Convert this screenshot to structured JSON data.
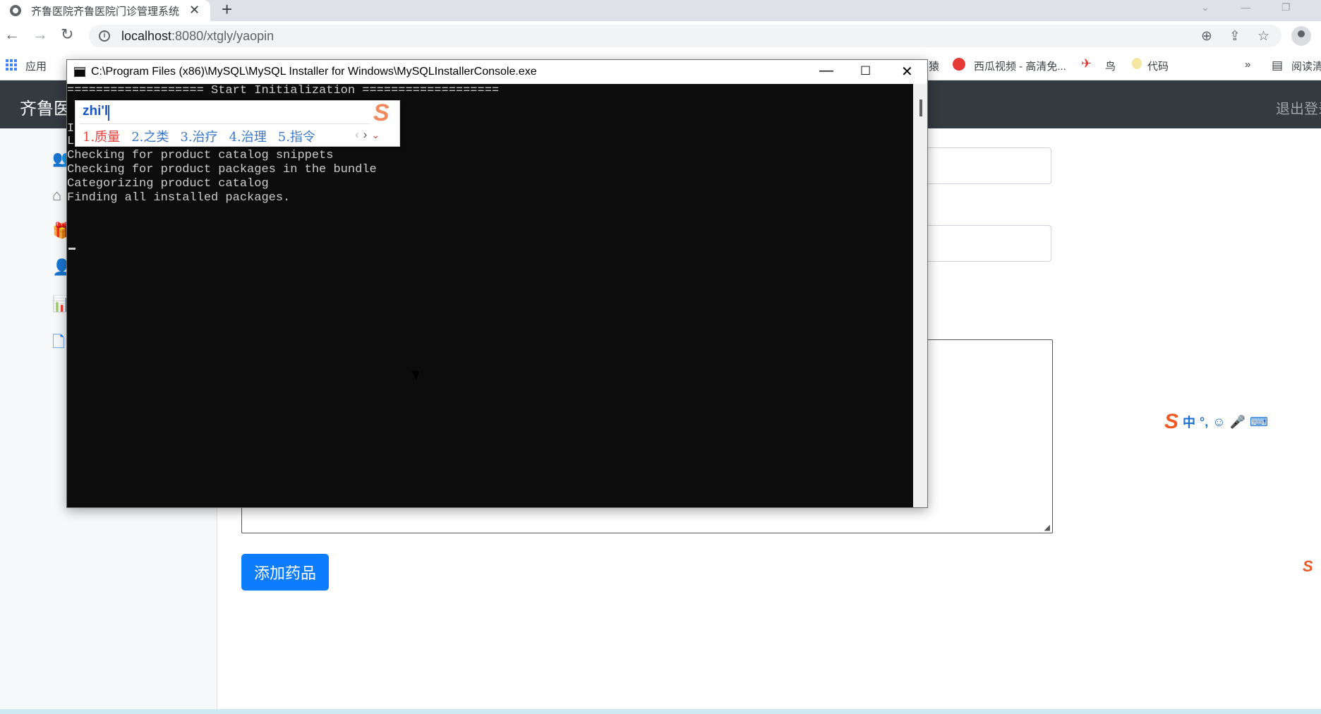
{
  "browser": {
    "tab_title": "齐鲁医院齐鲁医院门诊管理系统",
    "tab_close": "✕",
    "new_tab": "+",
    "url_host": "localhost",
    "url_rest": ":8080/xtgly/yaopin",
    "bookmarks": {
      "apps_label": "应用",
      "partial_left": "猿",
      "xigua": "西瓜视频 - 高清免...",
      "niao": "鸟",
      "daima": "代码",
      "more": "»",
      "reading": "阅读清"
    }
  },
  "app": {
    "brand": "齐鲁医院",
    "logout": "退出登录",
    "submit_label": "添加药品"
  },
  "console": {
    "title": "C:\\Program Files (x86)\\MySQL\\MySQL Installer for Windows\\MySQLInstallerConsole.exe",
    "lines": [
      "=================== Start Initialization ===================",
      "I",
      "Loading product catalog",
      "Checking for product catalog snippets",
      "Checking for product packages in the bundle",
      "Categorizing product catalog",
      "Finding all installed packages."
    ]
  },
  "ime": {
    "input": "zhi'l",
    "candidates": [
      "1.质量",
      "2.之类",
      "3.治疗",
      "4.治理",
      "5.指令"
    ],
    "logo": "S"
  },
  "sogou_toolbar": {
    "logo": "S",
    "items": [
      "中",
      "°,",
      "☺",
      "🎤",
      "⌨"
    ]
  },
  "colors": {
    "navbar": "#343a40",
    "primary_button": "#0d7cff",
    "console_bg": "#0c0c0c",
    "ime_selected": "#e0413a",
    "ime_candidate": "#3a78c9",
    "sogou_orange": "#ef5a24"
  }
}
